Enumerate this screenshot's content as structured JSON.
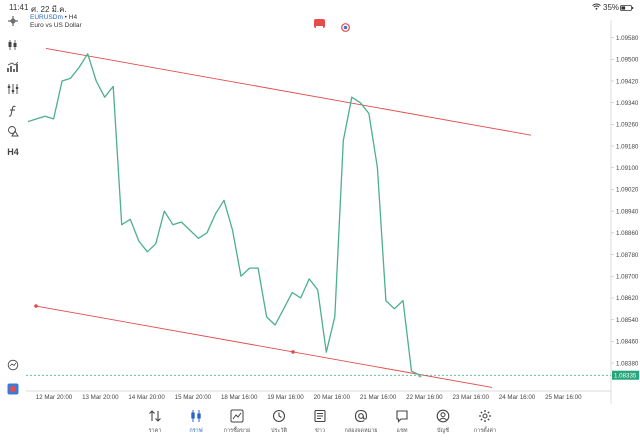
{
  "status_bar": {
    "time": "11:41",
    "date": "ศ. 22 มี.ค.",
    "battery": "35%"
  },
  "symbol": {
    "name": "EURUSDm",
    "separator": " • ",
    "timeframe": "H4",
    "description": "Euro vs US Dollar"
  },
  "toolbar": {
    "timeframe_label": "H4"
  },
  "colors": {
    "price_line": "#4caf8f",
    "trend_line": "#e34b4b",
    "current_price_bg": "#26a67a",
    "nav_active": "#2962c9",
    "badge_sell": "#e94b4b",
    "badge_buy": "#3a7bd5"
  },
  "chart_data": {
    "type": "line",
    "ylim": [
      1.0831,
      1.0963
    ],
    "y_ticks": [
      "1.09580",
      "1.09500",
      "1.09420",
      "1.09340",
      "1.09260",
      "1.09180",
      "1.09100",
      "1.09020",
      "1.08940",
      "1.08860",
      "1.08780",
      "1.08700",
      "1.08620",
      "1.08540",
      "1.08460",
      "1.08380"
    ],
    "x_ticks": [
      "12 Mar 20:00",
      "13 Mar 20:00",
      "14 Mar 20:00",
      "15 Mar 20:00",
      "18 Mar 16:00",
      "19 Mar 16:00",
      "20 Mar 16:00",
      "21 Mar 16:00",
      "22 Mar 16:00",
      "23 Mar 16:00",
      "24 Mar 16:00",
      "25 Mar 16:00"
    ],
    "series": [
      {
        "values": [
          1.0927,
          1.0928,
          1.0929,
          1.0928,
          1.0942,
          1.0943,
          1.0947,
          1.0952,
          1.0942,
          1.0936,
          1.094,
          1.0889,
          1.0891,
          1.0883,
          1.0879,
          1.0882,
          1.0894,
          1.0889,
          1.089,
          1.0887,
          1.0884,
          1.0886,
          1.0893,
          1.0898,
          1.0887,
          1.087,
          1.0873,
          1.0873,
          1.0855,
          1.0852,
          1.0858,
          1.0864,
          1.0862,
          1.0869,
          1.0865,
          1.0842,
          1.0855,
          1.092,
          1.0936,
          1.0934,
          1.093,
          1.091,
          1.0861,
          1.0858,
          1.0861,
          1.0835,
          1.08335
        ]
      }
    ],
    "trend_lines": [
      {
        "from": [
          1.0954
        ],
        "to": [
          1.0922
        ]
      },
      {
        "from": [
          1.0859
        ],
        "to": [
          1.0829
        ]
      }
    ],
    "current_price": "1.08335"
  },
  "bottom_nav": [
    {
      "label": "ราคา",
      "icon": "quotes-arrows-icon"
    },
    {
      "label": "กราฟ",
      "icon": "candles-icon",
      "active": true
    },
    {
      "label": "การซื้อขาย",
      "icon": "trade-chart-icon"
    },
    {
      "label": "ประวัติ",
      "icon": "history-clock-icon"
    },
    {
      "label": "ข่าว",
      "icon": "news-book-icon"
    },
    {
      "label": "กล่องจดหมาย",
      "icon": "mailbox-at-icon"
    },
    {
      "label": "แชท",
      "icon": "chat-bubble-icon"
    },
    {
      "label": "บัญชี",
      "icon": "account-person-icon"
    },
    {
      "label": "การตั้งค่า",
      "icon": "settings-gear-icon"
    }
  ]
}
